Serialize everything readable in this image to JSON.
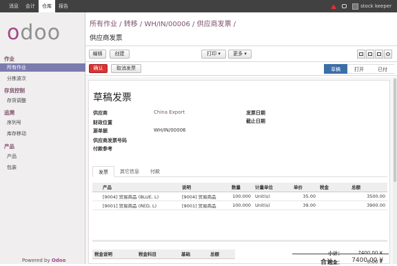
{
  "topbar": {
    "menu": [
      "消息",
      "会计",
      "仓库",
      "报告"
    ],
    "active_index": 2,
    "user": "stock keeper"
  },
  "sidebar": {
    "logo": "odoo",
    "sections": [
      {
        "title": "作业",
        "items": [
          "所有作业",
          "分拣波次"
        ]
      },
      {
        "title": "存货控制",
        "items": [
          "存货调整"
        ]
      },
      {
        "title": "追溯",
        "items": [
          "序列号",
          "库存移动"
        ]
      },
      {
        "title": "产品",
        "items": [
          "产品",
          "包装"
        ]
      }
    ],
    "active_item": "所有作业",
    "powered_prefix": "Powered by",
    "powered_brand": "Odoo"
  },
  "breadcrumb": "所有作业 / 转移 / WH/IN/00006 / 供应商发票 /",
  "subtitle": "供应商发票",
  "toolbar": {
    "edit": "编辑",
    "create": "创建",
    "print": "打印 ▾",
    "more": "更多 ▾"
  },
  "actions": {
    "confirm": "确认",
    "cancel": "取消发票"
  },
  "statusbar": [
    "草稿",
    "打开",
    "已付"
  ],
  "form": {
    "title": "草稿发票",
    "supplier_label": "供应商",
    "supplier_value": "China Export",
    "fiscal_position_label": "财政位置",
    "source_doc_label": "源单据",
    "source_doc_value": "WH/IN/00006",
    "supplier_invoice_no_label": "供应商发票号码",
    "payment_ref_label": "付款参考",
    "invoice_date_label": "发票日期",
    "due_date_label": "截止日期"
  },
  "tabs": [
    "发票",
    "其它信息",
    "付款"
  ],
  "lines": {
    "columns": [
      "产品",
      "说明",
      "数量",
      "计量单位",
      "单价",
      "税金",
      "总额"
    ],
    "rows": [
      [
        "[9004] 贸易商品 (BLUE, L)",
        "[9004] 贸易商品",
        "100.000",
        "Unit(s)",
        "35.00",
        "",
        "3500.00"
      ],
      [
        "[9001] 贸易商品 (RED, L)",
        "[9001] 贸易商品",
        "100.000",
        "Unit(s)",
        "39.00",
        "",
        "3900.00"
      ]
    ]
  },
  "tax_table": {
    "columns": [
      "税金说明",
      "税金科目",
      "基础",
      "总额"
    ]
  },
  "totals": {
    "subtotal_label": "小计：",
    "subtotal_value": "7400.00 ¥",
    "tax_label": "税金：",
    "tax_value": "0.00 ¥",
    "total_label": "合计：",
    "total_value": "7400.00 ¥"
  }
}
